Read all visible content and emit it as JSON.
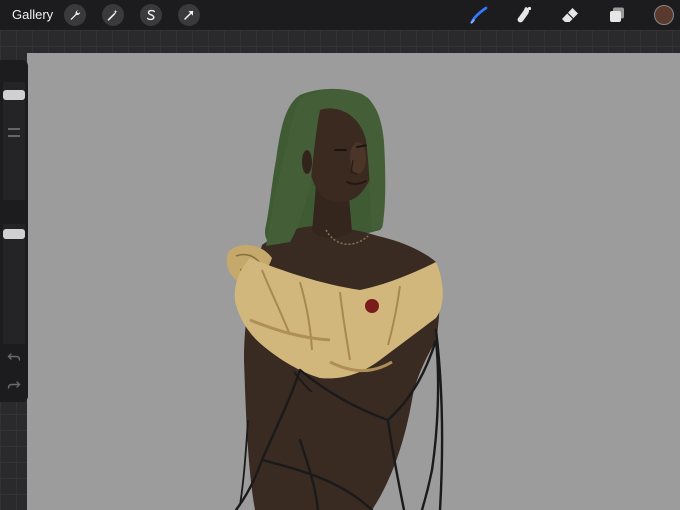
{
  "topbar": {
    "gallery_label": "Gallery",
    "left_tools": [
      "wrench-icon",
      "magic-wand-icon",
      "selection-s-icon",
      "arrow-transform-icon"
    ],
    "right_tools": [
      "brush-icon",
      "smudge-icon",
      "eraser-icon",
      "layers-icon"
    ],
    "active_tool": "brush",
    "active_tool_color": "#2f7bff",
    "current_color": "#5a3a2c"
  },
  "sidebar": {
    "brush_size_level": 0.12,
    "opacity_level": 0.18,
    "undo_icon": "undo-icon",
    "redo_icon": "redo-icon",
    "modify_icon": "square-modify-icon"
  },
  "canvas": {
    "background_color": "#9c9c9c",
    "artwork": "portrait-painting"
  }
}
